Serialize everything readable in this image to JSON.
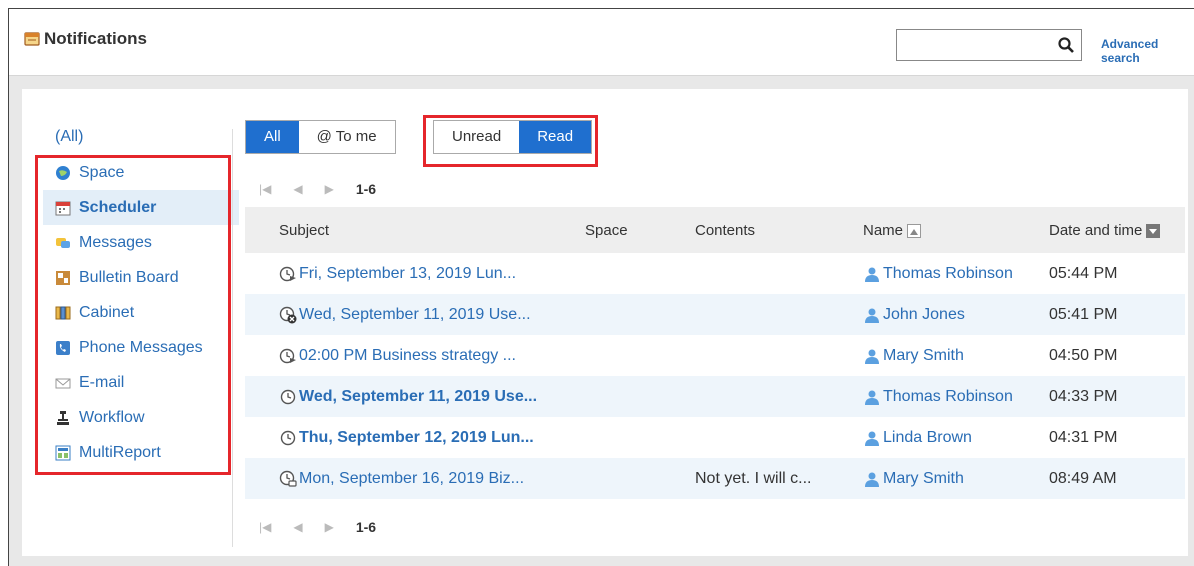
{
  "header": {
    "title": "Notifications",
    "advanced_search": "Advanced search",
    "search_value": ""
  },
  "sidebar": {
    "all_label": "(All)",
    "items": [
      {
        "label": "Space",
        "icon": "globe-icon"
      },
      {
        "label": "Scheduler",
        "icon": "calendar-icon",
        "active": true
      },
      {
        "label": "Messages",
        "icon": "messages-icon"
      },
      {
        "label": "Bulletin Board",
        "icon": "bulletin-icon"
      },
      {
        "label": "Cabinet",
        "icon": "cabinet-icon"
      },
      {
        "label": "Phone Messages",
        "icon": "phone-icon"
      },
      {
        "label": "E-mail",
        "icon": "mail-icon"
      },
      {
        "label": "Workflow",
        "icon": "workflow-icon"
      },
      {
        "label": "MultiReport",
        "icon": "multireport-icon"
      }
    ]
  },
  "filters": {
    "all": "All",
    "to_me": "@ To me",
    "unread": "Unread",
    "read": "Read"
  },
  "pager": {
    "range": "1-6"
  },
  "table": {
    "columns": [
      "Subject",
      "Space",
      "Contents",
      "Name",
      "Date and time"
    ],
    "rows": [
      {
        "subject": "Fri, September 13, 2019 Lun...",
        "space": "",
        "contents": "",
        "name": "Thomas Robinson",
        "time": "05:44 PM",
        "bold": false,
        "icon": "clock-arrow-icon"
      },
      {
        "subject": "Wed, September 11, 2019 Use...",
        "space": "",
        "contents": "",
        "name": "John Jones",
        "time": "05:41 PM",
        "bold": false,
        "icon": "clock-delete-icon"
      },
      {
        "subject": "02:00 PM Business strategy ...",
        "space": "",
        "contents": "",
        "name": "Mary Smith",
        "time": "04:50 PM",
        "bold": false,
        "icon": "clock-arrow-icon"
      },
      {
        "subject": "Wed, September 11, 2019 Use...",
        "space": "",
        "contents": "",
        "name": "Thomas Robinson",
        "time": "04:33 PM",
        "bold": true,
        "icon": "clock-icon"
      },
      {
        "subject": "Thu, September 12, 2019 Lun...",
        "space": "",
        "contents": "",
        "name": "Linda Brown",
        "time": "04:31 PM",
        "bold": true,
        "icon": "clock-icon"
      },
      {
        "subject": "Mon, September 16, 2019 Biz...",
        "space": "",
        "contents": "Not yet. I will c...",
        "name": "Mary Smith",
        "time": "08:49 AM",
        "bold": false,
        "icon": "clock-comment-icon"
      }
    ]
  },
  "colors": {
    "accent": "#1f6fcf",
    "link": "#2a6db5",
    "highlight": "#e5262b"
  }
}
